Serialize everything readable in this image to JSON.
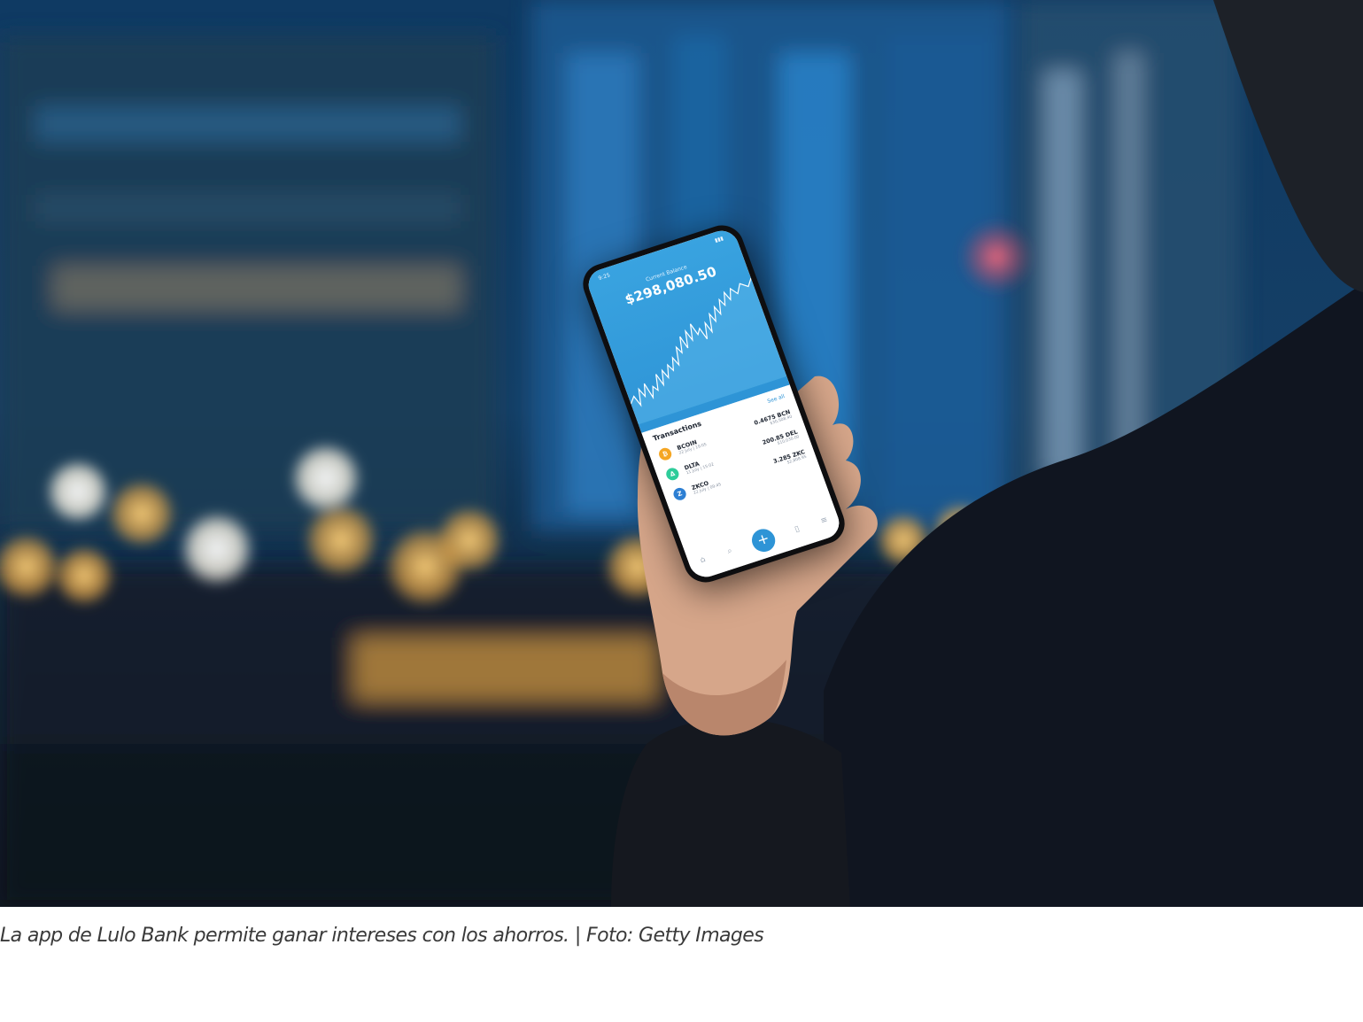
{
  "phone": {
    "status_time": "9:25",
    "balance_label": "Current Balance",
    "balance_value": "$298,080.50",
    "transactions_title": "Transactions",
    "see_all": "See all",
    "transactions": [
      {
        "name": "BCOIN",
        "date": "22 July | 19:05",
        "amount": "0.4675 BCN",
        "usd": "$30,508.40",
        "icon": "bitcoin-icon",
        "color": "#f5a623"
      },
      {
        "name": "DLTA",
        "date": "11 July | 15:02",
        "amount": "200.85 DEL",
        "usd": "$10,030.00",
        "icon": "delta-icon",
        "color": "#2ecc9a"
      },
      {
        "name": "ZKCO",
        "date": "22 July | 09:45",
        "amount": "3.285 ZKC",
        "usd": "$2,808.95",
        "icon": "zkco-icon",
        "color": "#2d7fd3"
      }
    ],
    "nav": {
      "add_label": "+"
    }
  },
  "caption": "La app de Lulo Bank permite ganar intereses con los ahorros. | Foto: Getty Images"
}
